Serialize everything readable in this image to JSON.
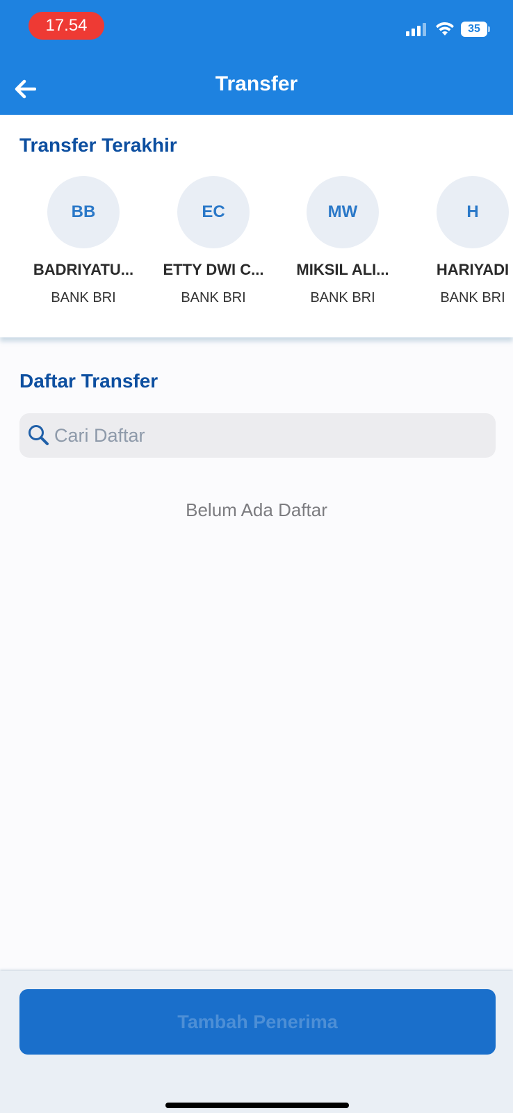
{
  "status_bar": {
    "time": "17.54",
    "battery_level": "35"
  },
  "header": {
    "title": "Transfer",
    "back_icon": "arrow-left-icon"
  },
  "recent": {
    "title": "Transfer Terakhir",
    "items": [
      {
        "initials": "BB",
        "name": "BADRIYATU...",
        "bank": "BANK BRI"
      },
      {
        "initials": "EC",
        "name": "ETTY DWI C...",
        "bank": "BANK BRI"
      },
      {
        "initials": "MW",
        "name": "MIKSIL ALI...",
        "bank": "BANK BRI"
      },
      {
        "initials": "H",
        "name": "HARIYADI",
        "bank": "BANK BRI"
      }
    ]
  },
  "list": {
    "title": "Daftar Transfer",
    "search_placeholder": "Cari Daftar",
    "empty_text": "Belum Ada Daftar"
  },
  "footer": {
    "add_button_label": "Tambah Penerima"
  },
  "colors": {
    "primary": "#1e82e0",
    "title_blue": "#0d4fa0",
    "time_pill": "#ee3a34",
    "button": "#1a6fcb"
  }
}
